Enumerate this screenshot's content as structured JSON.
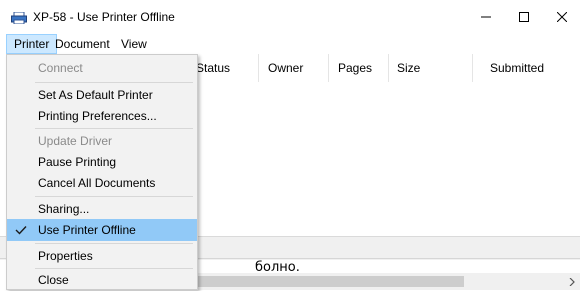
{
  "window": {
    "title": "XP-58  -  Use Printer Offline",
    "icons": {
      "app": "printer-icon",
      "minimize": "minimize-icon",
      "maximize": "maximize-icon",
      "close": "close-icon"
    }
  },
  "menubar": {
    "printer": "Printer",
    "document": "Document",
    "view": "View"
  },
  "columns": [
    "Status",
    "Owner",
    "Pages",
    "Size",
    "Submitted"
  ],
  "printer_menu": {
    "connect": "Connect",
    "set_default": "Set As Default Printer",
    "preferences": "Printing Preferences...",
    "update_driver": "Update Driver",
    "pause": "Pause Printing",
    "cancel_all": "Cancel All Documents",
    "sharing": "Sharing...",
    "use_offline": "Use Printer Offline",
    "properties": "Properties",
    "close": "Close"
  },
  "background_text": "болно.",
  "colors": {
    "menu_highlight": "#91c9f7",
    "menu_bg": "#f2f2f2",
    "disabled_text": "#8a8a8a"
  }
}
